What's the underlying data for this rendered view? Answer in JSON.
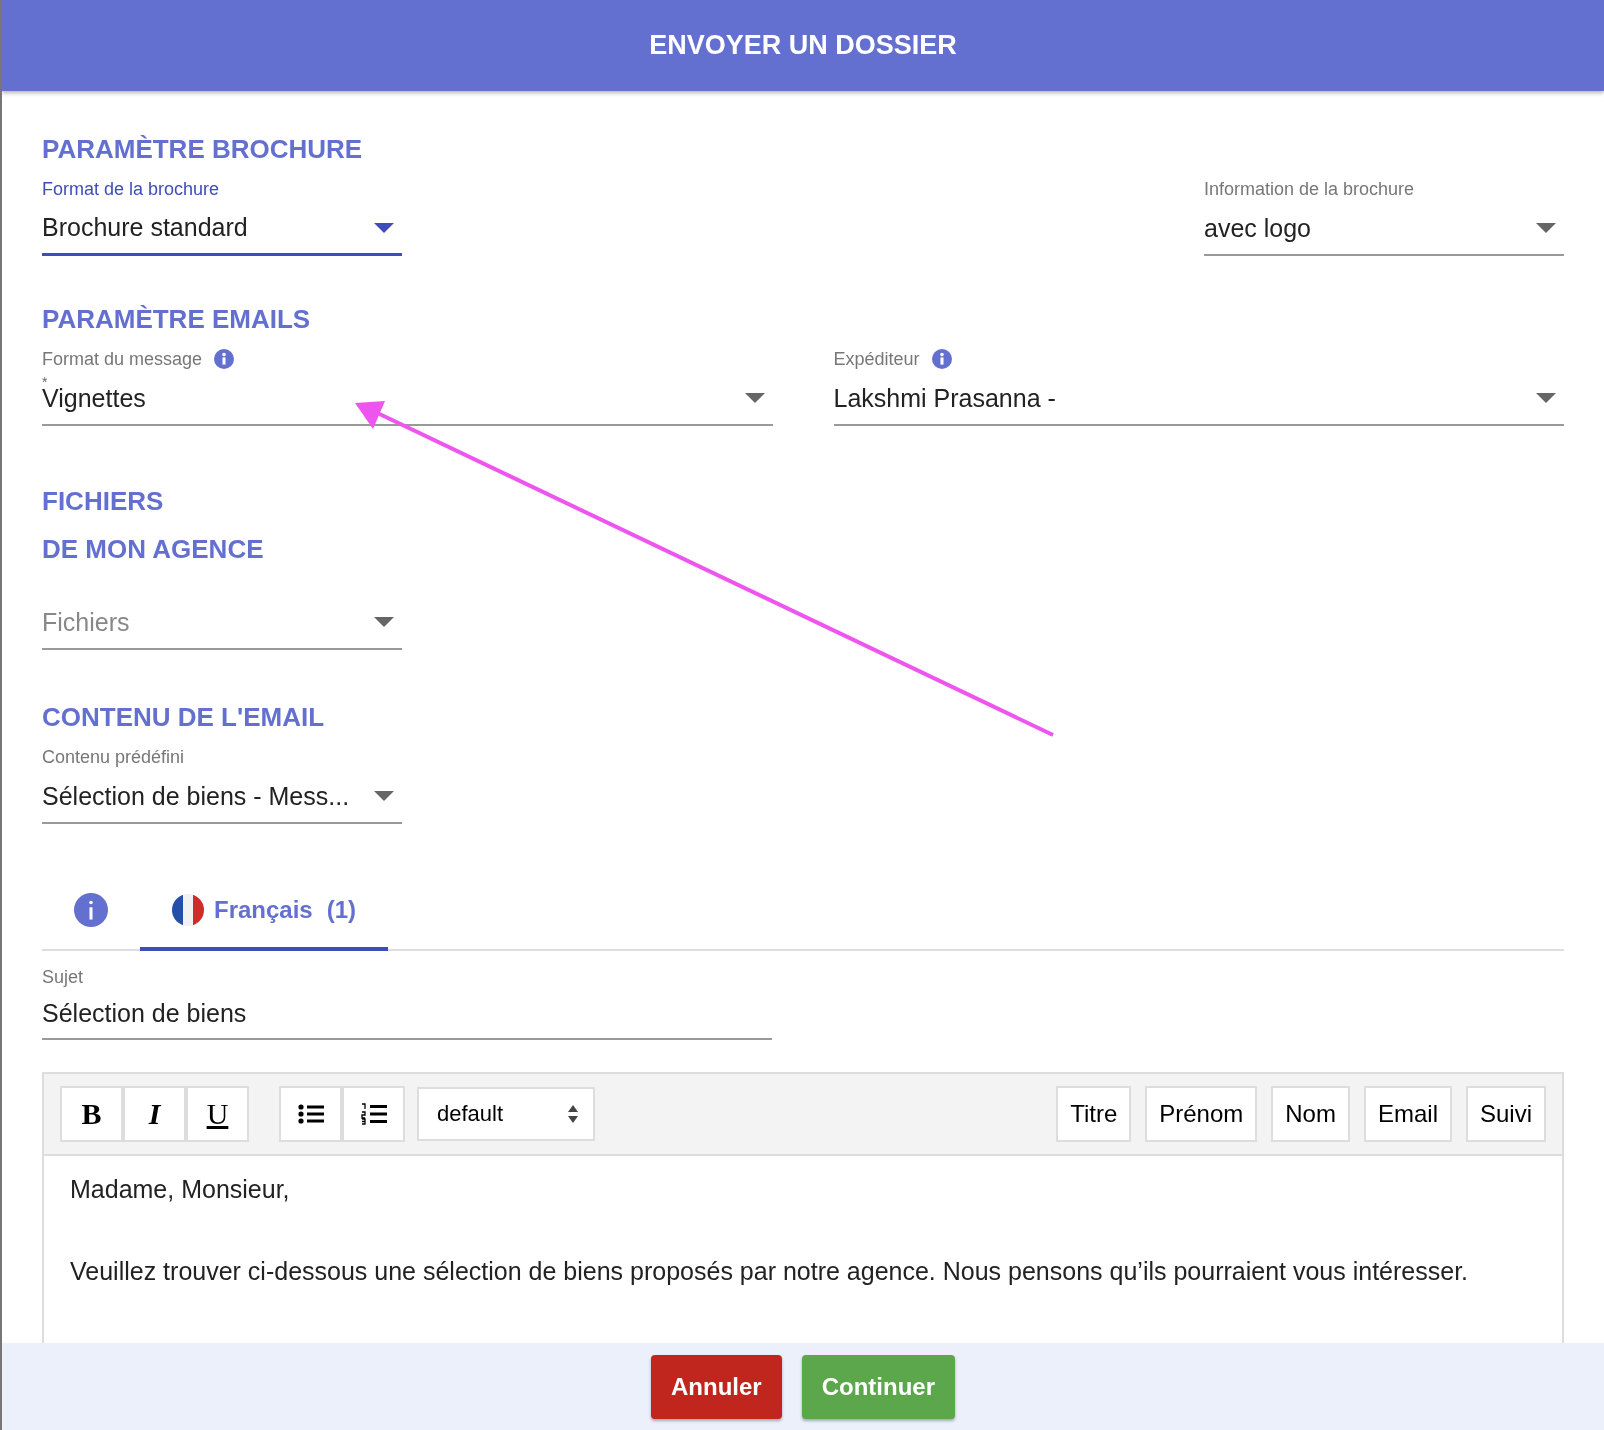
{
  "dialog": {
    "title": "ENVOYER UN DOSSIER"
  },
  "brochure": {
    "title": "PARAMÈTRE BROCHURE",
    "fields": [
      {
        "label": "Format de la brochure",
        "value": "Brochure standard",
        "focused": true
      },
      {
        "label": "Information de la brochure",
        "value": "avec logo",
        "focused": false
      }
    ]
  },
  "emails": {
    "title": "PARAMÈTRE EMAILS",
    "fields": [
      {
        "label": "Format du message",
        "value": "Vignettes",
        "required_mark": "*",
        "focused": false,
        "info": true
      },
      {
        "label": "Expéditeur",
        "value": "Lakshmi Prasanna -",
        "focused": false,
        "info": true
      }
    ]
  },
  "files": {
    "title": "FICHIERS",
    "subtitle": "DE MON AGENCE",
    "field": {
      "placeholder": "Fichiers",
      "focused": false
    }
  },
  "content": {
    "title": "CONTENU DE L'EMAIL",
    "field": {
      "label": "Contenu prédéfini",
      "value": "Sélection de biens - Mess...",
      "focused": false
    }
  },
  "tabs": [
    {
      "kind": "info",
      "selected": false
    },
    {
      "kind": "language",
      "label": "Français",
      "count": "(1)",
      "selected": true
    }
  ],
  "subject": {
    "label": "Sujet",
    "value": "Sélection de biens"
  },
  "editor": {
    "format_buttons": [
      {
        "kind": "bold",
        "label": "B"
      },
      {
        "kind": "italic",
        "label": "I"
      },
      {
        "kind": "underline",
        "label": "U"
      }
    ],
    "list_buttons": [
      {
        "kind": "bullets"
      },
      {
        "kind": "numbered"
      }
    ],
    "style_select": "default",
    "field_buttons": [
      "Titre",
      "Prénom",
      "Nom",
      "Email",
      "Suivi"
    ],
    "paragraphs": [
      "Madame, Monsieur,",
      "Veuillez trouver ci-dessous une sélection de biens proposés par notre agence. Nous pensons qu’ils pourraient vous intéresser."
    ]
  },
  "footer": {
    "buttons": [
      {
        "kind": "cancel",
        "label": "Annuler"
      },
      {
        "kind": "confirm",
        "label": "Continuer"
      }
    ]
  }
}
